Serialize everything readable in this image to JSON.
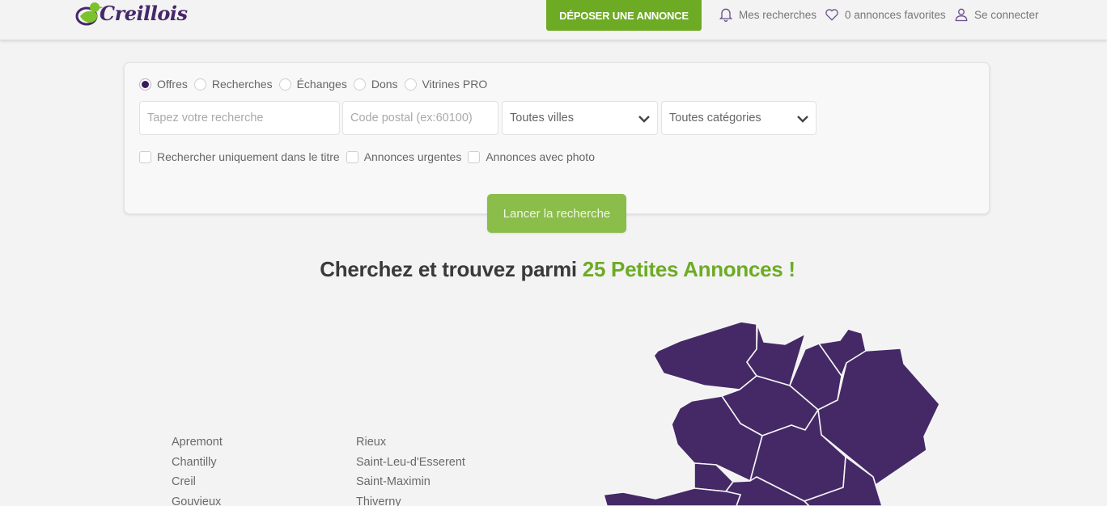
{
  "header": {
    "logo_text": "Creillois",
    "post_button": "DÉPOSER UNE ANNONCE",
    "nav": [
      {
        "icon": "bell-icon",
        "label": "Mes recherches"
      },
      {
        "icon": "heart-icon",
        "label": "0 annonces favorites"
      },
      {
        "icon": "user-icon",
        "label": "Se connecter"
      }
    ]
  },
  "search": {
    "types": [
      {
        "label": "Offres",
        "checked": true
      },
      {
        "label": "Recherches",
        "checked": false
      },
      {
        "label": "Échanges",
        "checked": false
      },
      {
        "label": "Dons",
        "checked": false
      },
      {
        "label": "Vitrines PRO",
        "checked": false
      }
    ],
    "query": {
      "value": "",
      "placeholder": "Tapez votre recherche"
    },
    "postal": {
      "value": "",
      "placeholder": "Code postal (ex:60100)"
    },
    "city_select": "Toutes villes",
    "category_select": "Toutes catégories",
    "options": [
      {
        "label": "Rechercher uniquement dans le titre",
        "checked": false
      },
      {
        "label": "Annonces urgentes",
        "checked": false
      },
      {
        "label": "Annonces avec photo",
        "checked": false
      }
    ],
    "submit": "Lancer la recherche"
  },
  "headline": {
    "text": "Cherchez et trouvez parmi",
    "accent": "25 Petites Annonces !"
  },
  "cities": {
    "column1": [
      "Apremont",
      "Chantilly",
      "Creil",
      "Gouvieux"
    ],
    "column2": [
      "Rieux",
      "Saint-Leu-d'Esserent",
      "Saint-Maximin",
      "Thiverny"
    ]
  },
  "colors": {
    "brand_green": "#6eab25",
    "brand_purple": "#452966",
    "button_light_green": "#8bbd4b"
  }
}
